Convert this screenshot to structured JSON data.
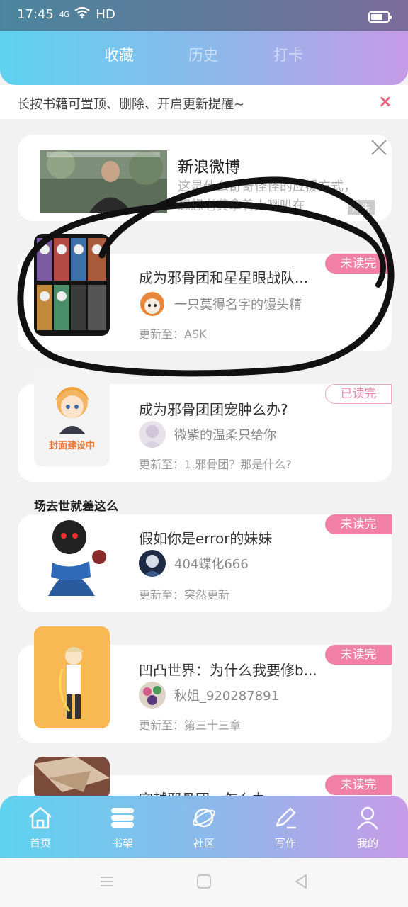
{
  "status": {
    "time": "17:45",
    "signal": "4G",
    "wifi": "HD"
  },
  "tabs": [
    {
      "label": "收藏",
      "active": true
    },
    {
      "label": "历史",
      "active": false
    },
    {
      "label": "打卡",
      "active": false
    }
  ],
  "tip": {
    "text": "长按书籍可置顶、删除、开启更新提醒~",
    "close": "×"
  },
  "ad": {
    "title": "新浪微博",
    "desc": "这是什么奇奇怪怪的应援方式，想想老龚拿着大喇叭在",
    "tag": "广告"
  },
  "books": [
    {
      "title": "成为邪骨团和星星眼战队...",
      "author": "一只莫得名字的馒头精",
      "update": "更新至：ASK",
      "badge": "未读完",
      "badge_type": "unread"
    },
    {
      "title": "成为邪骨团团宠肿么办?",
      "author": "微紫的温柔只给你",
      "update": "更新至：1.邪骨团？那是什么?",
      "badge": "已读完",
      "badge_type": "read",
      "cover_text": "封面建设中"
    },
    {
      "title": "假如你是error的妹妹",
      "author": "404蝶化666",
      "update": "更新至：突然更新",
      "badge": "未读完",
      "badge_type": "unread"
    },
    {
      "title": "凹凸世界：为什么我要修b...",
      "author": "秋姐_920287891",
      "update": "更新至：第三十三章",
      "badge": "未读完",
      "badge_type": "unread"
    },
    {
      "title": "穿越邪骨团，怎么办",
      "badge": "未读完",
      "badge_type": "unread"
    }
  ],
  "overhang_text": "场去世就差这么",
  "bottom_nav": [
    {
      "label": "首页",
      "icon": "home-icon"
    },
    {
      "label": "书架",
      "icon": "bookshelf-icon"
    },
    {
      "label": "社区",
      "icon": "planet-icon"
    },
    {
      "label": "写作",
      "icon": "pen-icon"
    },
    {
      "label": "我的",
      "icon": "user-icon"
    }
  ],
  "colors": {
    "accent": "#f27fa5",
    "gradient_start": "#5ed3f0",
    "gradient_end": "#c79be8"
  }
}
